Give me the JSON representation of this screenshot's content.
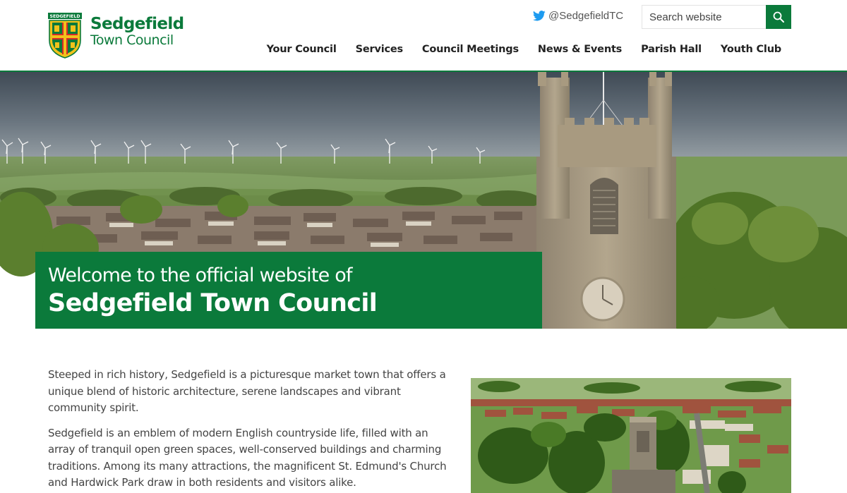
{
  "brand": {
    "title": "Sedgefield",
    "subtitle": "Town Council",
    "crest_label": "SEDGEFIELD"
  },
  "header": {
    "twitter_handle": "@SedgefieldTC",
    "search_placeholder": "Search website"
  },
  "nav": {
    "items": [
      "Your Council",
      "Services",
      "Council Meetings",
      "News & Events",
      "Parish Hall",
      "Youth Club"
    ]
  },
  "hero": {
    "line1": "Welcome to the official website of",
    "line2": "Sedgefield Town Council"
  },
  "content": {
    "paragraphs": [
      "Steeped in rich history, Sedgefield is a picturesque market town that offers a unique blend of historic architecture, serene landscapes and vibrant community spirit.",
      "Sedgefield is an emblem of modern English countryside life, filled with an array of tranquil open green spaces, well-conserved buildings and charming traditions. Among its many attractions, the magnificent St. Edmund's Church and Hardwick Park draw in both residents and visitors alike."
    ]
  },
  "colors": {
    "brand_green": "#0b7a3b",
    "twitter_blue": "#1d9bf0",
    "text_dark": "#222222",
    "text_body": "#444444"
  },
  "icons": {
    "twitter": "twitter-bird-icon",
    "search": "magnifier-icon",
    "crest": "town-crest-icon"
  }
}
